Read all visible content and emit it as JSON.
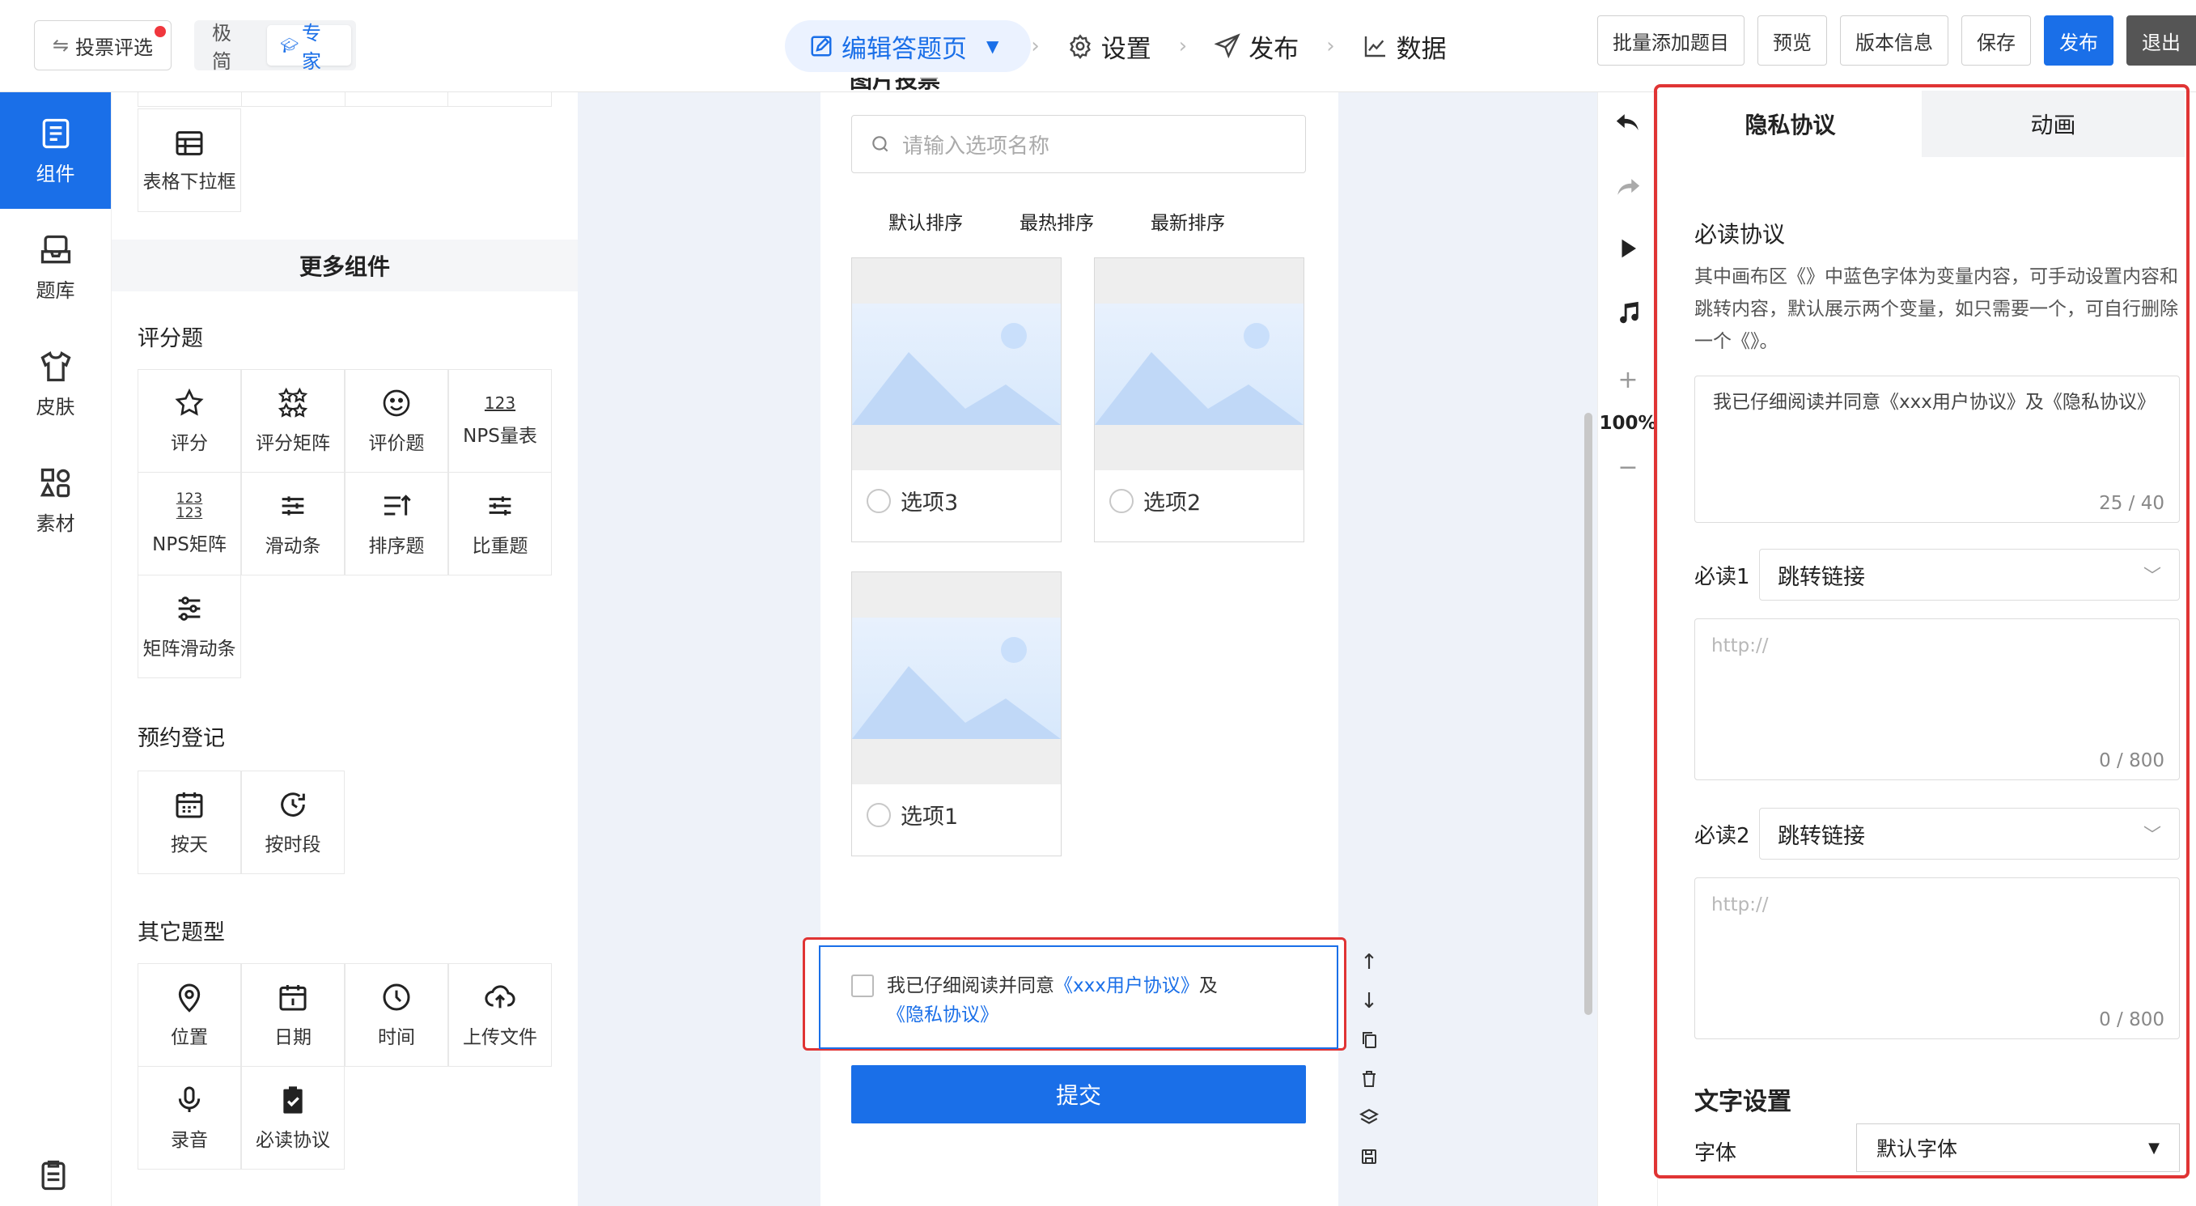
{
  "topbar": {
    "vote_filter": "投票评选",
    "mode_simple": "极简",
    "mode_expert": "专家",
    "steps": {
      "edit": "编辑答题页",
      "settings": "设置",
      "publish": "发布",
      "data": "数据"
    },
    "actions": {
      "batch_add": "批量添加题目",
      "preview": "预览",
      "version": "版本信息",
      "save": "保存",
      "publish": "发布",
      "exit": "退出"
    }
  },
  "rail": {
    "components": "组件",
    "library": "题库",
    "skin": "皮肤",
    "material": "素材"
  },
  "components": {
    "top_item": "表格下拉框",
    "more_header": "更多组件",
    "rating": {
      "title": "评分题",
      "items": [
        "评分",
        "评分矩阵",
        "评价题",
        "NPS量表",
        "NPS矩阵",
        "滑动条",
        "排序题",
        "比重题",
        "矩阵滑动条"
      ],
      "nps_icon_text": "123"
    },
    "booking": {
      "title": "预约登记",
      "items": [
        "按天",
        "按时段"
      ]
    },
    "other": {
      "title": "其它题型",
      "items": [
        "位置",
        "日期",
        "时间",
        "上传文件",
        "录音",
        "必读协议"
      ]
    }
  },
  "canvas": {
    "section_cut": "图片投票",
    "search_placeholder": "请输入选项名称",
    "sort": [
      "默认排序",
      "最热排序",
      "最新排序"
    ],
    "options": [
      "选项3",
      "选项2",
      "选项1"
    ],
    "agree_prefix": "我已仔细阅读并同意",
    "agree_link1": "《xxx用户协议》",
    "agree_mid": "及",
    "agree_link2": "《隐私协议》",
    "submit": "提交"
  },
  "tools": {
    "zoom": "100%"
  },
  "props": {
    "tab_privacy": "隐私协议",
    "tab_animation": "动画",
    "required_title": "必读协议",
    "description": "其中画布区《》中蓝色字体为变量内容，可手动设置内容和跳转内容，默认展示两个变量，如只需要一个，可自行删除一个《》。",
    "agreement_text": "我已仔细阅读并同意《xxx用户协议》及《隐私协议》",
    "agreement_count": "25 / 40",
    "read1_label": "必读1",
    "read2_label": "必读2",
    "jump_link": "跳转链接",
    "url_placeholder": "http://",
    "url_count": "0 / 800",
    "text_settings": "文字设置",
    "font_label": "字体",
    "font_value": "默认字体"
  }
}
